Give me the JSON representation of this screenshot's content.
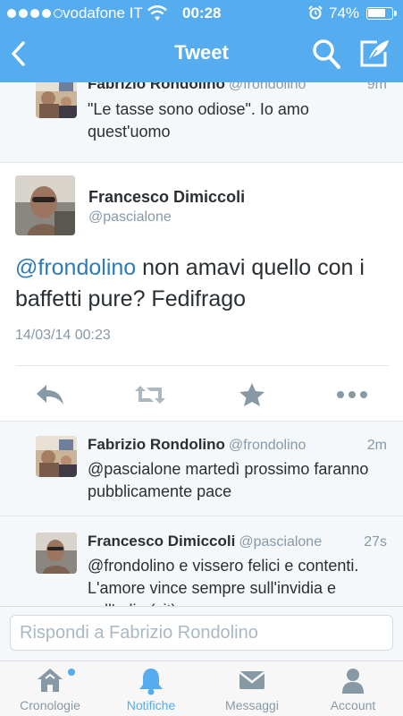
{
  "status_bar": {
    "carrier": "vodafone IT",
    "time": "00:28",
    "battery_percent": "74%",
    "battery_level": 0.74
  },
  "nav": {
    "title": "Tweet",
    "icons": [
      "back-chevron-icon",
      "search-icon",
      "compose-icon"
    ]
  },
  "replies_above": [
    {
      "name": "Fabrizio Rondolino",
      "handle": "@frondolino",
      "time": "9m",
      "text": "\"Le tasse sono odiose\". Io amo quest'uomo"
    }
  ],
  "main_tweet": {
    "name": "Francesco Dimiccoli",
    "handle": "@pascialone",
    "mention": "@frondolino",
    "text": " non amavi quello con i baffetti pure? Fedifrago",
    "date": "14/03/14 00:23",
    "actions": [
      "reply-icon",
      "retweet-icon",
      "favorite-star-icon",
      "more-dots-icon"
    ]
  },
  "replies_below": [
    {
      "name": "Fabrizio Rondolino",
      "handle": "@frondolino",
      "time": "2m",
      "text": "@pascialone martedì prossimo faranno pubblicamente pace"
    },
    {
      "name": "Francesco Dimiccoli",
      "handle": "@pascialone",
      "time": "27s",
      "text": "@frondolino e vissero felici e contenti. L'amore vince sempre sull'invidia e sull'odio (cit)"
    }
  ],
  "composer": {
    "placeholder": "Rispondi a Fabrizio Rondolino"
  },
  "tabbar": {
    "tabs": [
      {
        "label": "Cronologie",
        "icon": "home-icon",
        "active": false
      },
      {
        "label": "Notifiche",
        "icon": "bell-icon",
        "active": true
      },
      {
        "label": "Messaggi",
        "icon": "envelope-icon",
        "active": false
      },
      {
        "label": "Account",
        "icon": "person-icon",
        "active": false
      }
    ]
  },
  "colors": {
    "brand_blue": "#55acee",
    "link_blue": "#2b7bb9",
    "muted_gray": "#8899a6",
    "reply_background": "#f5f8fa"
  }
}
